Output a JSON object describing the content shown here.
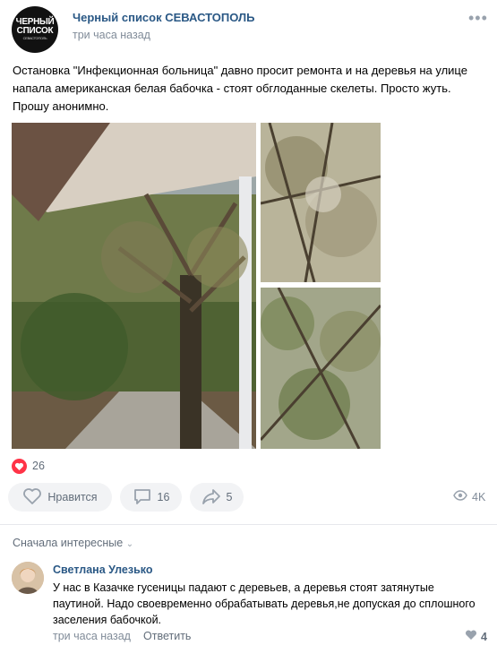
{
  "post": {
    "group_name": "Черный список СЕВАСТОПОЛЬ",
    "avatar_text": [
      "ЧЕРНЫЙ",
      "СПИСОК",
      "СЕВАСТОПОЛЬ"
    ],
    "time": "три часа назад",
    "more_icon": "more-horizontal-icon",
    "text": "Остановка \"Инфекционная больница\" давно просит ремонта и на деревья на улице напала американская белая бабочка - стоят обглоданные скелеты. Просто жуть. Прошу анонимно.",
    "photos": [
      "bus-stop-tree-photo",
      "tree-branches-closeup-photo",
      "tree-leaves-photo"
    ],
    "likes_count": "26",
    "buttons": {
      "like_label": "Нравится",
      "comment_count": "16",
      "share_count": "5"
    },
    "views": "4K"
  },
  "comments_section": {
    "sort_label": "Сначала интересные",
    "comments": [
      {
        "author": "Светлана Улезько",
        "text": "У нас в Казачке гусеницы падают с деревьев, а деревья стоят затянутые паутиной. Надо своевременно обрабатывать деревья,не допуская до сплошного заселения бабочкой.",
        "time": "три часа назад",
        "reply_label": "Ответить",
        "likes": "4"
      }
    ]
  },
  "colors": {
    "link": "#2a5885",
    "secondary": "#818c99",
    "like_red": "#ff3347",
    "button_bg": "#f2f3f5"
  }
}
